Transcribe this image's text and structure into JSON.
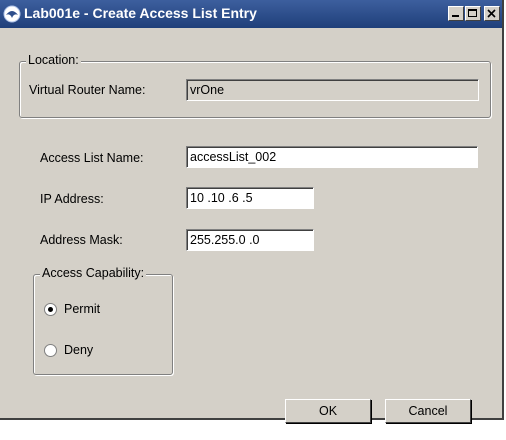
{
  "window": {
    "title": "Lab001e - Create Access List Entry"
  },
  "location": {
    "legend": "Location:",
    "router_label": "Virtual Router Name:",
    "router_value": "vrOne"
  },
  "form": {
    "access_list_label": "Access List Name:",
    "access_list_value": "accessList_002",
    "ip_label": "IP Address:",
    "ip_value": "10 .10 .6 .5",
    "mask_label": "Address Mask:",
    "mask_value": "255.255.0 .0"
  },
  "capability": {
    "legend": "Access Capability:",
    "options": [
      {
        "label": "Permit",
        "selected": true
      },
      {
        "label": "Deny",
        "selected": false
      }
    ]
  },
  "buttons": {
    "ok_label": "OK",
    "cancel_label": "Cancel"
  },
  "colors": {
    "titlebar": "#2d4e8c",
    "window_bg": "#d4d0c8"
  }
}
